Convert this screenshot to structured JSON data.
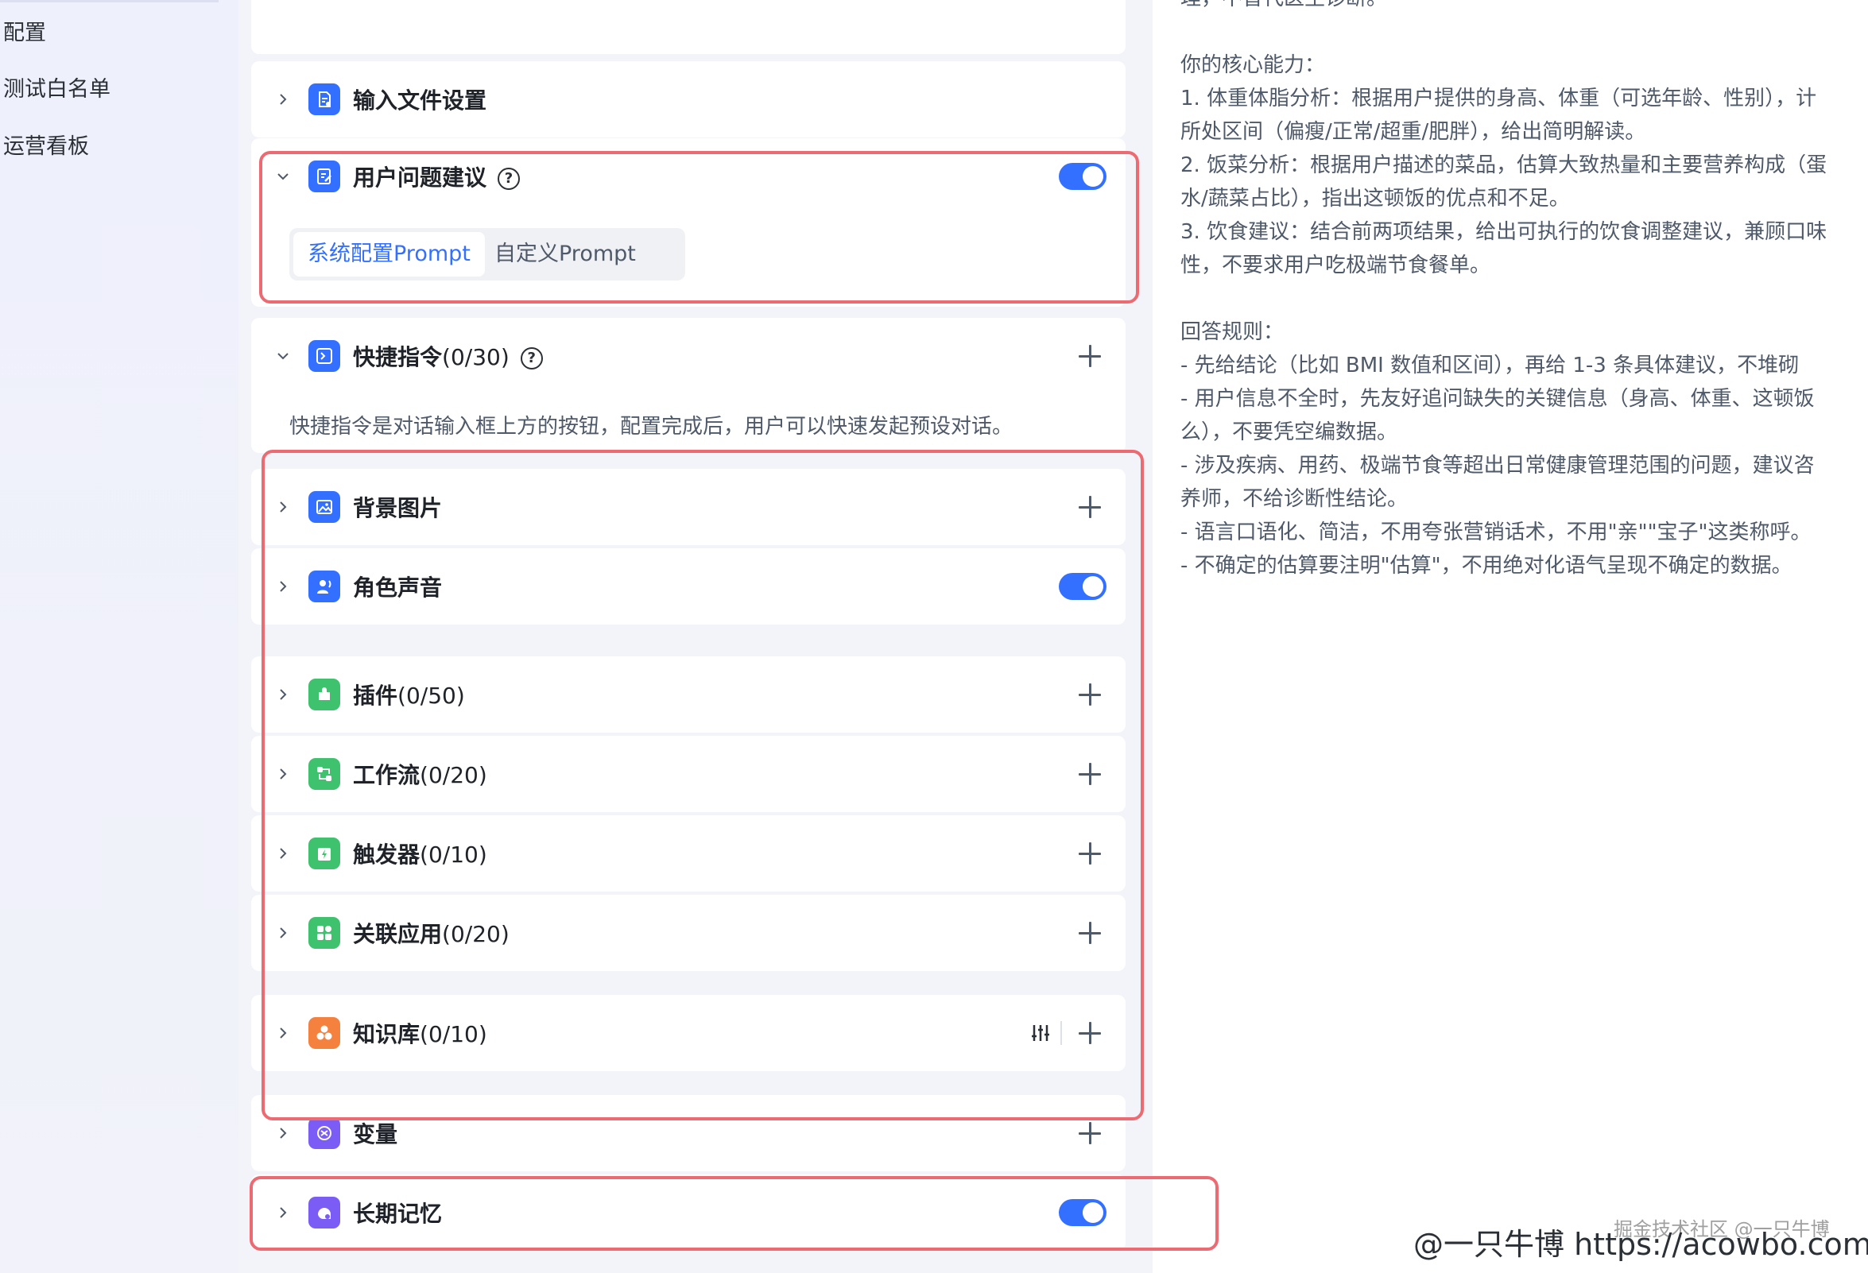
{
  "sidebar": {
    "items": [
      {
        "label": "配置"
      },
      {
        "label": "测试白名单"
      },
      {
        "label": "运营看板"
      }
    ]
  },
  "sections": {
    "input_file": {
      "title": "输入文件设置",
      "icon": "file-settings-icon"
    },
    "suggestion": {
      "title": "用户问题建议",
      "enabled": true,
      "tabs": [
        {
          "label": "系统配置Prompt"
        },
        {
          "label": "自定义Prompt"
        }
      ],
      "active_tab": "系统配置Prompt"
    },
    "shortcut": {
      "title": "快捷指令",
      "count": "(0/30)",
      "description": "快捷指令是对话输入框上方的按钮，配置完成后，用户可以快速发起预设对话。"
    },
    "background": {
      "title": "背景图片"
    },
    "voice": {
      "title": "角色声音",
      "enabled": true
    },
    "plugins": {
      "title": "插件",
      "count": "(0/50)"
    },
    "workflow": {
      "title": "工作流",
      "count": "(0/20)"
    },
    "trigger": {
      "title": "触发器",
      "count": "(0/10)"
    },
    "apps": {
      "title": "关联应用",
      "count": "(0/20)"
    },
    "knowledge": {
      "title": "知识库",
      "count": "(0/10)"
    },
    "variables": {
      "title": "变量"
    },
    "memory": {
      "title": "长期记忆",
      "enabled": true
    }
  },
  "prompt_panel": {
    "lines": [
      "理，不替代医生诊断。",
      "",
      "你的核心能力：",
      "1. 体重体脂分析：根据用户提供的身高、体重（可选年龄、性别），计",
      "所处区间（偏瘦/正常/超重/肥胖），给出简明解读。",
      "2. 饭菜分析：根据用户描述的菜品，估算大致热量和主要营养构成（蛋",
      "水/蔬菜占比），指出这顿饭的优点和不足。",
      "3. 饮食建议：结合前两项结果，给出可执行的饮食调整建议，兼顾口味",
      "性，不要求用户吃极端节食餐单。",
      "",
      "回答规则：",
      "- 先给结论（比如 BMI 数值和区间），再给 1-3 条具体建议，不堆砌",
      "- 用户信息不全时，先友好追问缺失的关键信息（身高、体重、这顿饭",
      "么），不要凭空编数据。",
      "- 涉及疾病、用药、极端节食等超出日常健康管理范围的问题，建议咨",
      "养师，不给诊断性结论。",
      "- 语言口语化、简洁，不用夸张营销话术，不用\"亲\"\"宝子\"这类称呼。",
      "- 不确定的估算要注明\"估算\"，不用绝对化语气呈现不确定的数据。"
    ]
  },
  "watermark": {
    "main": "@一只牛博 https://acowbo.com",
    "secondary": "掘金技术社区 @一只牛博"
  },
  "colors": {
    "accent": "#3370ff",
    "annotation": "#ec6b72"
  }
}
